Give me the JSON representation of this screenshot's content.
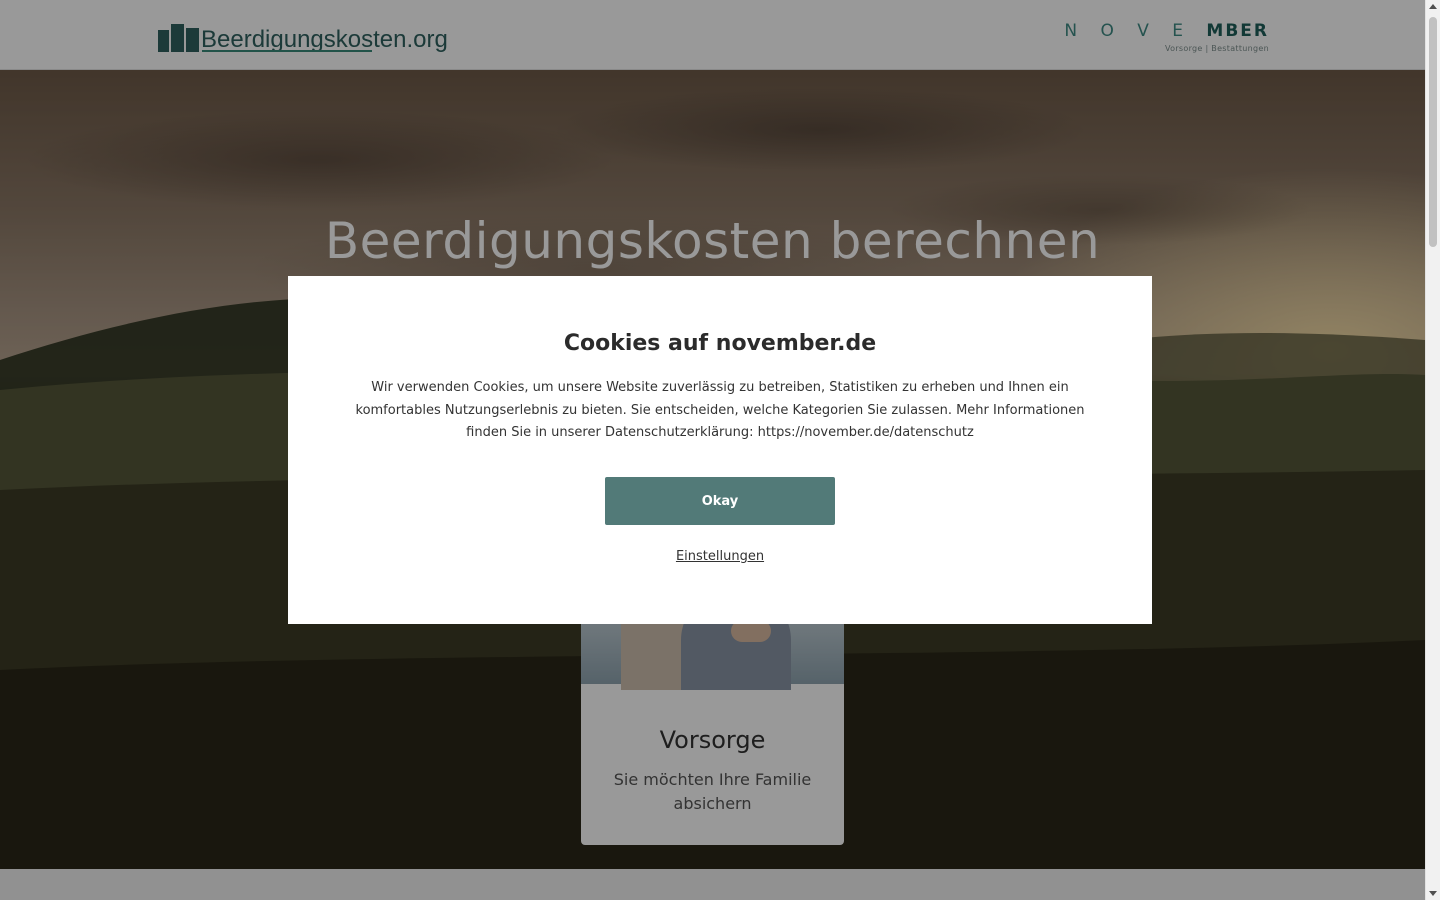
{
  "header": {
    "logo_text": "Beerdigungskosten.org",
    "brand_name_light": "N O V E ",
    "brand_name_bold": "MBER",
    "brand_tagline": "Vorsorge | Bestattungen"
  },
  "hero": {
    "title": "Beerdigungskosten berechnen"
  },
  "card": {
    "title": "Vorsorge",
    "subtitle": "Sie möchten Ihre Familie absichern"
  },
  "cookie_modal": {
    "title": "Cookies auf november.de",
    "text": "Wir verwenden Cookies, um unsere Website zuverlässig zu betreiben, Statistiken zu erheben und Ihnen ein komfortables Nutzungserlebnis zu bieten. Sie entscheiden, welche Kategorien Sie zulassen. Mehr Informationen finden Sie in unserer Datenschutzerklärung: https://november.de/datenschutz",
    "okay_label": "Okay",
    "settings_label": "Einstellungen"
  },
  "colors": {
    "accent": "#527a78",
    "brand": "#2f6260",
    "overlay": "rgba(0,0,0,0.4)"
  }
}
